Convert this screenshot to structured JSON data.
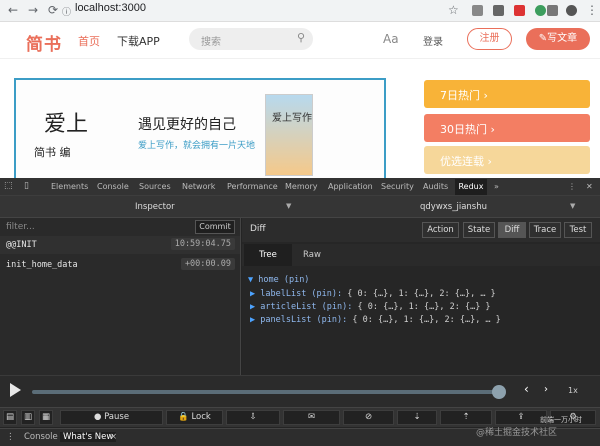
{
  "browser": {
    "back_icon": "back-arrow-icon",
    "forward_icon": "forward-arrow-icon",
    "reload_icon": "reload-icon",
    "url": "localhost:3000",
    "url_icon": "info-icon",
    "star_icon": "star-icon"
  },
  "site": {
    "logo": "简书",
    "nav_home": "首页",
    "nav_download": "下载APP",
    "search_placeholder": "搜索",
    "font_toggle": "Aa",
    "login": "登录",
    "register": "注册",
    "write": "✎写文章",
    "banner": {
      "title": "爱上",
      "subtitle": "遇见更好的自己",
      "line1": "爱上写作，就会拥有一片天地",
      "left_bottom": "简书 编"
    },
    "book": {
      "title": "爱上写作"
    },
    "side_cards": [
      {
        "label": "7日热门 ›",
        "color": "#f8b338"
      },
      {
        "label": "30日热门 ›",
        "color": "#f37e63"
      },
      {
        "label": "优选连载 ›",
        "color": "#f6d79a"
      }
    ]
  },
  "devtools": {
    "tabs": [
      "Elements",
      "Console",
      "Sources",
      "Network",
      "Performance",
      "Memory",
      "Application",
      "Security",
      "Audits",
      "Redux",
      "»"
    ],
    "active_tab": "Redux"
  },
  "redux": {
    "inspector_label": "Inspector",
    "instance_label": "qdywxs_jianshu",
    "filter_placeholder": "filter...",
    "commit_label": "Commit",
    "actions": [
      {
        "name": "@@INIT",
        "time": "10:59:04.75"
      },
      {
        "name": "init_home_data",
        "time": "+00:00.09"
      }
    ],
    "panel_title": "Diff",
    "view_buttons": [
      "Action",
      "State",
      "Diff",
      "Trace",
      "Test"
    ],
    "active_view": "Diff",
    "sub_tabs": [
      "Tree",
      "Raw"
    ],
    "active_sub_tab": "Tree",
    "tree": {
      "root": "home (pin)",
      "rows": [
        {
          "key": "labelList (pin):",
          "value": "{ 0: {…}, 1: {…}, 2: {…}, … }"
        },
        {
          "key": "articleList (pin):",
          "value": "{ 0: {…}, 1: {…}, 2: {…} }"
        },
        {
          "key": "panelsList (pin):",
          "value": "{ 0: {…}, 1: {…}, 2: {…}, … }"
        }
      ]
    },
    "slider_position": 0.99,
    "speed": "1x",
    "bottom_buttons": [
      "Pause",
      "Lock"
    ],
    "pause_icon": "pause-icon",
    "lock_icon": "lock-icon"
  },
  "drawer": {
    "tabs": [
      "Console",
      "What's New"
    ],
    "active_tab": "What's New",
    "close": "×"
  },
  "watermark": {
    "text": "@稀土掘金技术社区",
    "top_text": "前端一万小时"
  },
  "colors": {
    "brand": "#ea6f5a",
    "devtools_bg": "#242424",
    "slider_track": "#5b6d78"
  }
}
